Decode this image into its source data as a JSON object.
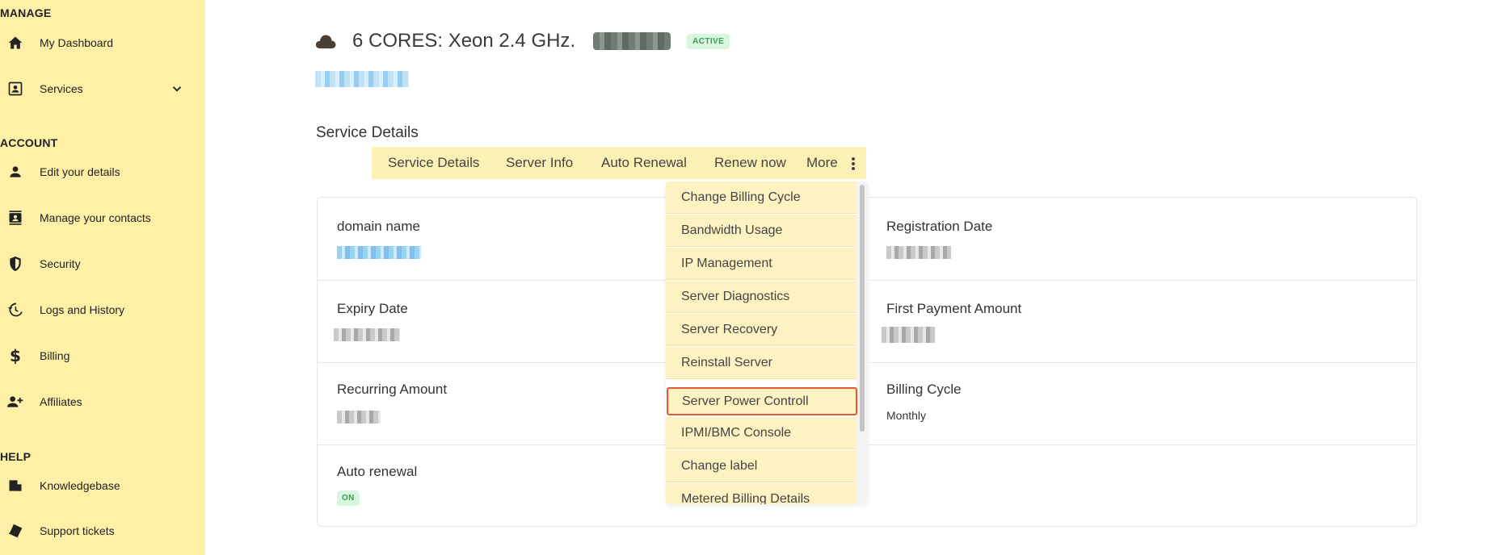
{
  "sidebar": {
    "sections": {
      "manage": "MANAGE",
      "account": "ACCOUNT",
      "help": "HELP"
    },
    "items": {
      "dashboard": {
        "label": "My Dashboard",
        "icon": "home-icon"
      },
      "services": {
        "label": "Services",
        "icon": "portrait-icon"
      },
      "edit_details": {
        "label": "Edit your details",
        "icon": "person-icon"
      },
      "contacts": {
        "label": "Manage your contacts",
        "icon": "contacts-icon"
      },
      "security": {
        "label": "Security",
        "icon": "shield-icon"
      },
      "logs": {
        "label": "Logs and History",
        "icon": "history-icon"
      },
      "billing": {
        "label": "Billing",
        "icon": "dollar-icon"
      },
      "affiliates": {
        "label": "Affiliates",
        "icon": "add-person-icon"
      },
      "knowledgebase": {
        "label": "Knowledgebase",
        "icon": "book-icon"
      },
      "support": {
        "label": "Support tickets",
        "icon": "ticket-icon"
      }
    },
    "colors": {
      "background": "#fef0a6"
    }
  },
  "header": {
    "title": "6 CORES: Xeon 2.4 GHz.",
    "status": "ACTIVE"
  },
  "section_title": "Service Details",
  "tabs": {
    "service_details": "Service Details",
    "server_info": "Server Info",
    "auto_renewal": "Auto Renewal",
    "renew_now": "Renew now",
    "more": "More"
  },
  "fields": {
    "domain_name": "domain name",
    "registration_date": "Registration Date",
    "expiry_date": "Expiry Date",
    "first_payment": "First Payment Amount",
    "recurring_amount": "Recurring Amount",
    "billing_cycle": "Billing Cycle",
    "billing_cycle_value": "Monthly",
    "auto_renewal": "Auto renewal",
    "auto_renewal_value": "ON"
  },
  "dropdown": {
    "items": [
      "Change Billing Cycle",
      "Bandwidth Usage",
      "IP Management",
      "Server Diagnostics",
      "Server Recovery",
      "Reinstall Server",
      "Server Power Controll",
      "IPMI/BMC Console",
      "Change label",
      "Metered Billing Details"
    ],
    "highlight_color": "#e65a3a"
  }
}
